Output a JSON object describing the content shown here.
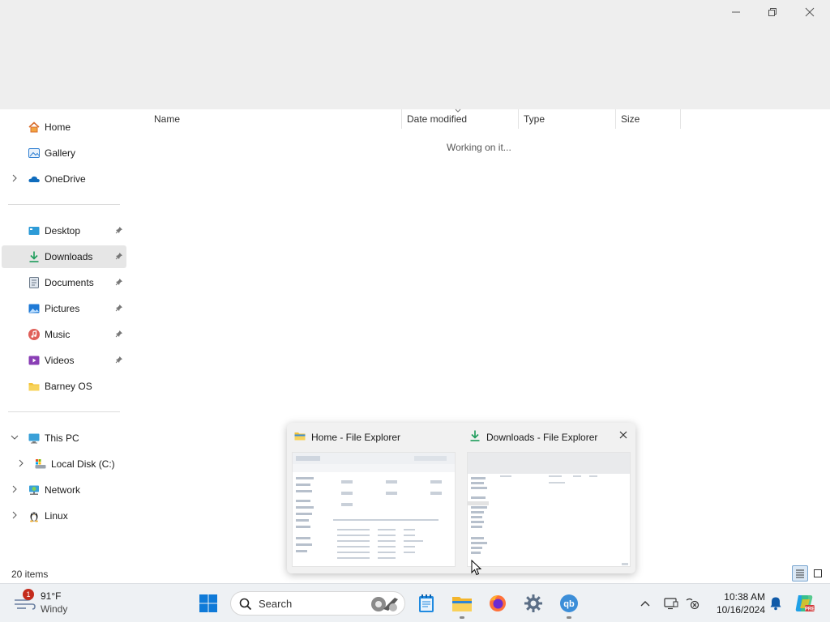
{
  "window": {
    "minimize_label": "—",
    "maximize_label": "❐",
    "close_label": "✕"
  },
  "sidebar": {
    "quick": [
      {
        "label": "Home",
        "icon": "home-icon"
      },
      {
        "label": "Gallery",
        "icon": "gallery-icon"
      },
      {
        "label": "OneDrive",
        "icon": "onedrive-icon",
        "expandable": true
      }
    ],
    "pinned": [
      {
        "label": "Desktop",
        "icon": "desktop-icon",
        "pinned": true
      },
      {
        "label": "Downloads",
        "icon": "downloads-icon",
        "pinned": true,
        "selected": true
      },
      {
        "label": "Documents",
        "icon": "documents-icon",
        "pinned": true
      },
      {
        "label": "Pictures",
        "icon": "pictures-icon",
        "pinned": true
      },
      {
        "label": "Music",
        "icon": "music-icon",
        "pinned": true
      },
      {
        "label": "Videos",
        "icon": "videos-icon",
        "pinned": true
      },
      {
        "label": "Barney OS",
        "icon": "folder-icon",
        "pinned": false
      }
    ],
    "devices": [
      {
        "label": "This PC",
        "icon": "this-pc-icon",
        "expanded": true
      },
      {
        "label": "Local Disk (C:)",
        "icon": "local-disk-icon"
      },
      {
        "label": "Network",
        "icon": "network-icon"
      },
      {
        "label": "Linux",
        "icon": "linux-icon"
      }
    ]
  },
  "content": {
    "columns": [
      "Name",
      "Date modified",
      "Type",
      "Size"
    ],
    "status_message": "Working on it..."
  },
  "status_bar": {
    "item_count": "20 items"
  },
  "thumbnails": [
    {
      "title": "Home - File Explorer",
      "icon": "folder-icon"
    },
    {
      "title": "Downloads - File Explorer",
      "icon": "downloads-icon",
      "close_label": "✕"
    }
  ],
  "taskbar": {
    "weather": {
      "temp": "91°F",
      "condition": "Windy",
      "badge": "1"
    },
    "search_label": "Search",
    "time": "10:38 AM",
    "date": "10/16/2024"
  },
  "colors": {
    "accent": "#0078d4",
    "selected_bg": "#e6e6e6",
    "downloads_green": "#1c9c5a"
  }
}
